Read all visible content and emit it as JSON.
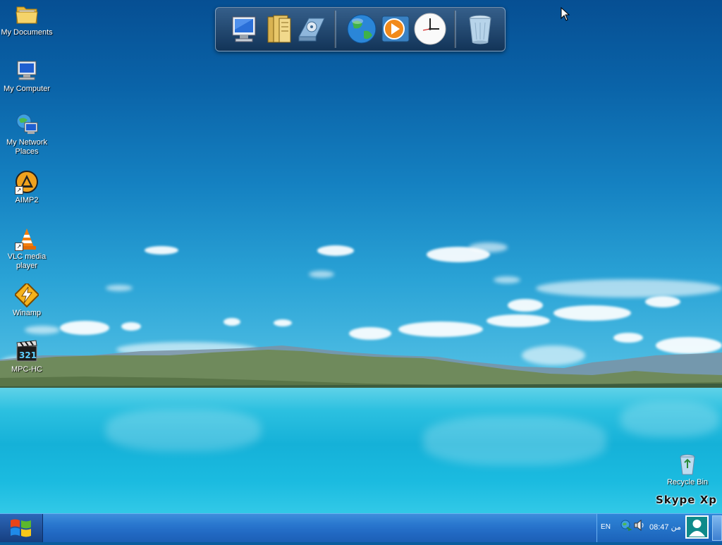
{
  "desktop": {
    "icons": [
      {
        "name": "my-documents",
        "label": "My Documents"
      },
      {
        "name": "my-computer",
        "label": "My Computer"
      },
      {
        "name": "my-network-places",
        "label": "My Network Places"
      },
      {
        "name": "aimp2",
        "label": "AIMP2"
      },
      {
        "name": "vlc-media-player",
        "label": "VLC media player"
      },
      {
        "name": "winamp",
        "label": "Winamp"
      },
      {
        "name": "mpc-hc",
        "label": "MPC-HC"
      },
      {
        "name": "recycle-bin",
        "label": "Recycle Bin"
      }
    ],
    "watermark": "Skype Xp"
  },
  "dock": {
    "items": [
      {
        "name": "my-computer",
        "icon": "monitor-icon"
      },
      {
        "name": "documents",
        "icon": "folder-icon"
      },
      {
        "name": "drive",
        "icon": "disk-drive-icon"
      },
      {
        "name": "internet",
        "icon": "globe-icon"
      },
      {
        "name": "media-player",
        "icon": "play-icon"
      },
      {
        "name": "clock",
        "icon": "clock-icon"
      },
      {
        "name": "recycle-bin",
        "icon": "trash-icon"
      }
    ]
  },
  "taskbar": {
    "start_icon": "windows-logo-icon",
    "language": "EN",
    "clock": "08:47 من",
    "tray_icons": [
      "network-icon",
      "volume-icon"
    ],
    "colors": {
      "bar": "#2a78cf",
      "start": "#163f80"
    }
  }
}
